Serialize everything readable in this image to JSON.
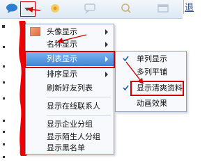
{
  "topbar": {
    "right_text": "退"
  },
  "main_menu": {
    "items": [
      {
        "label": "头像显示",
        "submenu": true
      },
      {
        "label": "名称显示",
        "submenu": true
      },
      {
        "label": "列表显示",
        "submenu": true
      },
      {
        "label": "排序显示",
        "submenu": true
      },
      {
        "label": "刷新好友列表",
        "submenu": false
      },
      {
        "label": "显示在线联系人",
        "submenu": false
      },
      {
        "label": "显示企业分组",
        "submenu": false
      },
      {
        "label": "显示陌生人分组",
        "submenu": false
      },
      {
        "label": "显示黑名单",
        "submenu": false
      }
    ]
  },
  "sub_menu": {
    "items": [
      {
        "label": "单列显示",
        "checked": true
      },
      {
        "label": "多列平铺",
        "checked": false
      },
      {
        "label": "显示清爽资料",
        "checked": true
      },
      {
        "label": "动画效果",
        "checked": false
      }
    ]
  },
  "colors": {
    "annotation": "#d40000",
    "highlight": "#3b84d9"
  }
}
